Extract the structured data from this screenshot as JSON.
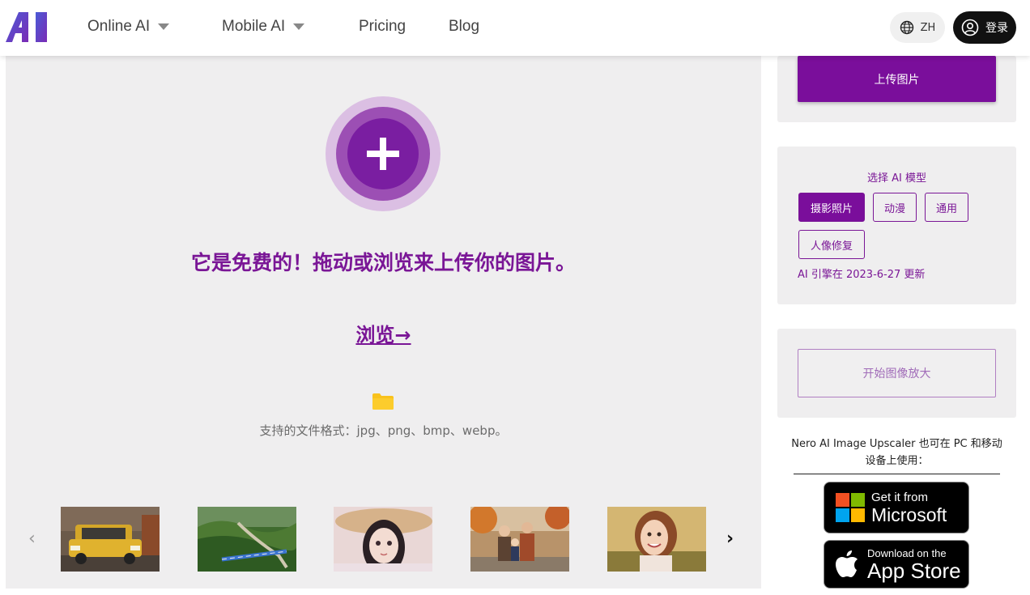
{
  "header": {
    "logo_text": "AI",
    "nav": [
      {
        "label": "Online AI",
        "has_dropdown": true
      },
      {
        "label": "Mobile AI",
        "has_dropdown": true
      },
      {
        "label": "Pricing",
        "has_dropdown": false
      },
      {
        "label": "Blog",
        "has_dropdown": false
      }
    ],
    "lang_label": "ZH",
    "login_label": "登录"
  },
  "upload": {
    "title": "它是免费的！拖动或浏览来上传你的图片。",
    "browse_label": "浏览→",
    "formats_text": "支持的文件格式：jpg、png、bmp、webp。"
  },
  "carousel": {
    "prev_icon": "chevron-left-icon",
    "next_icon": "chevron-right-icon",
    "thumbnails": [
      "yellow-car",
      "train-landscape",
      "anime-girl",
      "family-autumn",
      "smiling-woman"
    ]
  },
  "sidebar": {
    "upload_button_label": "上传图片",
    "model_title": "选择 AI 模型",
    "models": [
      {
        "label": "摄影照片",
        "active": true
      },
      {
        "label": "动漫",
        "active": false
      },
      {
        "label": "通用",
        "active": false
      },
      {
        "label": "人像修复",
        "active": false
      }
    ],
    "engine_note": "AI 引擎在 2023-6-27 更新",
    "start_button_label": "开始图像放大",
    "availability_text": "Nero AI Image Upscaler 也可在 PC 和移动设备上使用：",
    "microsoft_badge": {
      "line1": "Get it from",
      "line2": "Microsoft"
    },
    "appstore_badge": {
      "line1": "Download on the",
      "line2": "App Store"
    }
  },
  "colors": {
    "brand_purple": "#7a0e9b",
    "panel_bg": "#efeeef",
    "header_bg": "#ffffff"
  }
}
